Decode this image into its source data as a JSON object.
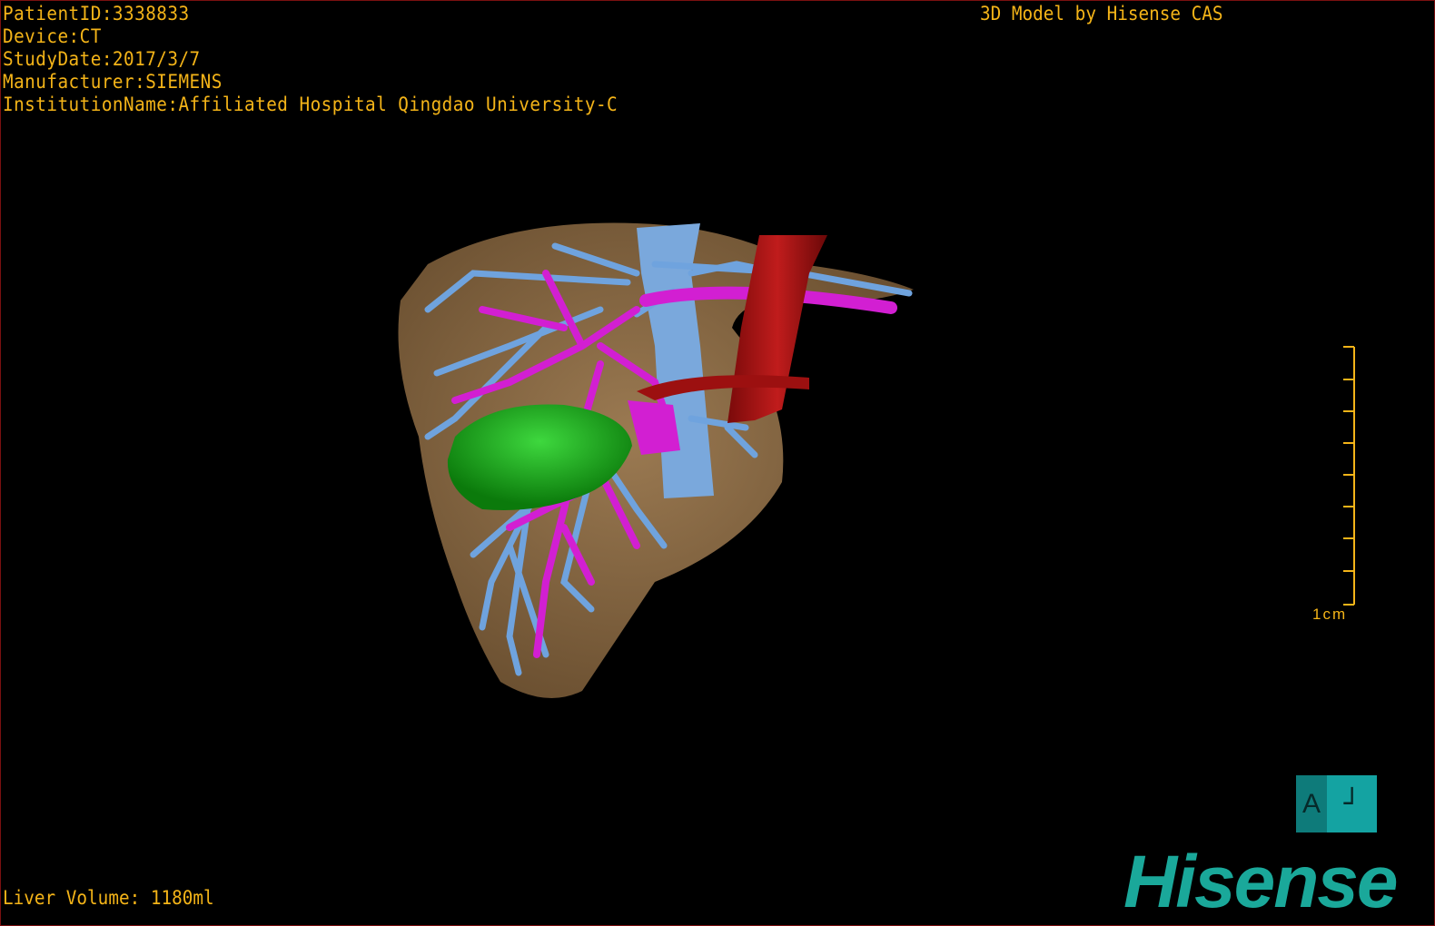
{
  "info": {
    "patient_id": "PatientID:3338833",
    "device": "Device:CT",
    "study_date": "StudyDate:2017/3/7",
    "manufacturer": "Manufacturer:SIEMENS",
    "institution": "InstitutionName:Affiliated Hospital Qingdao University-C"
  },
  "brand_text": "3D Model by Hisense CAS",
  "liver_volume": "Liver Volume: 1180ml",
  "scale_bar": {
    "label": "1cm"
  },
  "orientation_cube": {
    "face_left": "A",
    "face_right": "┘"
  },
  "logo": "Hisense",
  "colors": {
    "text": "#f4b418",
    "liver": "#8a6a44",
    "portal_vein": "#6fa3de",
    "hepatic_vessel": "#d21fd2",
    "artery": "#b31515",
    "tumor": "#169a16",
    "logo": "#1aa89a"
  }
}
